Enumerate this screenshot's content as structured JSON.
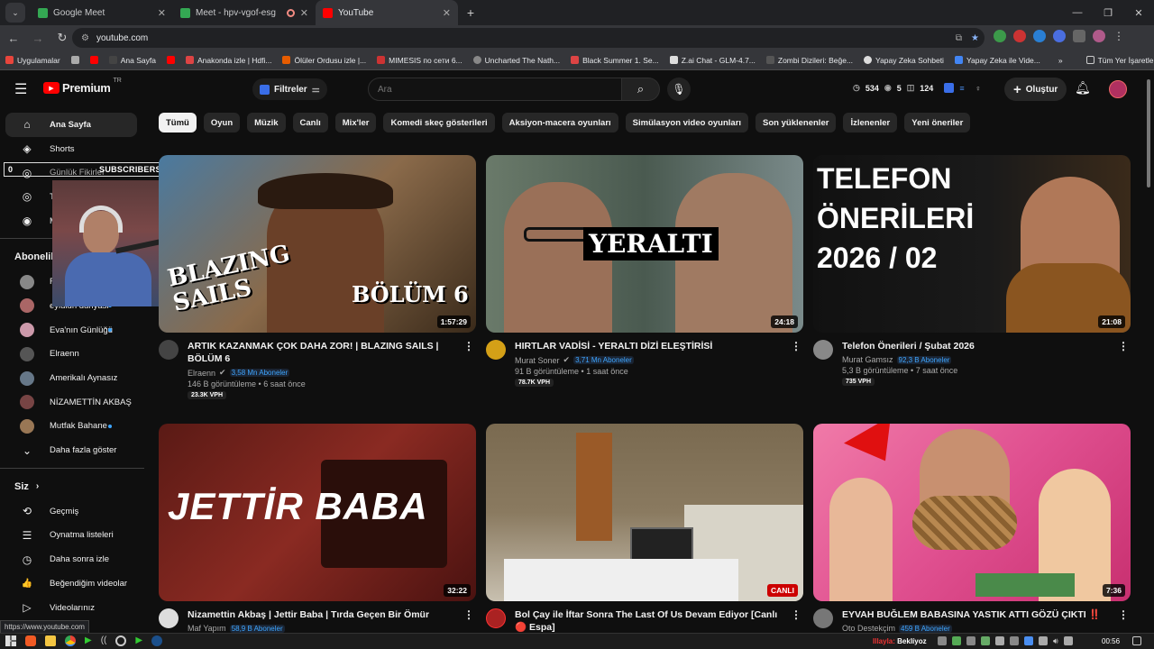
{
  "browser": {
    "tabs": [
      {
        "title": "Google Meet",
        "color": "#34a853",
        "active": false
      },
      {
        "title": "Meet - hpv-vgof-esg",
        "color": "#34a853",
        "active": false,
        "recording": true
      },
      {
        "title": "YouTube",
        "color": "#ff0000",
        "active": true
      }
    ],
    "url": "youtube.com",
    "bookmarks": [
      {
        "label": "Uygulamalar",
        "color": "#e8453c"
      },
      {
        "label": "",
        "color": "#aaa"
      },
      {
        "label": "",
        "color": "#ff0000"
      },
      {
        "label": "Ana Sayfa",
        "color": "#444"
      },
      {
        "label": "",
        "color": "#ff0000"
      },
      {
        "label": "Anakonda izle | Hdfi...",
        "color": "#d44"
      },
      {
        "label": "Ölüler Ordusu izle |...",
        "color": "#e65c00"
      },
      {
        "label": "MIMESIS по сети 6...",
        "color": "#c33"
      },
      {
        "label": "Uncharted The Nath...",
        "color": "#888"
      },
      {
        "label": "Black Summer 1. Se...",
        "color": "#d44"
      },
      {
        "label": "Z.ai Chat - GLM-4.7...",
        "color": "#ddd"
      },
      {
        "label": "Zombi Dizileri: Beğe...",
        "color": "#555"
      },
      {
        "label": "Yapay Zeka Sohbeti",
        "color": "#ddd"
      },
      {
        "label": "Yapay Zeka ile Vide...",
        "color": "#4285f4"
      }
    ],
    "bookmarks_more": "»",
    "all_bookmarks": "Tüm Yer İşaretleri",
    "status_url": "https://www.youtube.com"
  },
  "header": {
    "logo_text": "Premium",
    "logo_region": "TR",
    "filters_label": "Filtreler",
    "search_placeholder": "Ara",
    "stats": {
      "a": "534",
      "b": "5",
      "c": "124"
    },
    "create_label": "Oluştur"
  },
  "overlay": {
    "sub_count": "0",
    "sub_label": "SUBSCRIBERS",
    "sub_goal": "6"
  },
  "sidebar": {
    "main": [
      {
        "label": "Ana Sayfa",
        "icon": "home-icon",
        "glyph": "⌂",
        "active": true
      },
      {
        "label": "Shorts",
        "icon": "shorts-icon",
        "glyph": "◈"
      },
      {
        "label": "Günlük Fikirler",
        "icon": "ideas-icon",
        "glyph": "◎"
      },
      {
        "label": "T",
        "icon": "subscriptions-icon",
        "glyph": "◎"
      },
      {
        "label": "M",
        "icon": "music-icon",
        "glyph": "◉"
      }
    ],
    "subs_title": "Abonelik",
    "subs": [
      {
        "label": "RF",
        "color": "#888"
      },
      {
        "label": "eylulun dunyasi",
        "color": "#a66",
        "dot": true
      },
      {
        "label": "Eva'nın Günlüğü",
        "color": "#c9a",
        "dot": true
      },
      {
        "label": "Elraenn",
        "color": "#555"
      },
      {
        "label": "Amerikalı Aynasız",
        "color": "#678"
      },
      {
        "label": "NİZAMETTİN AKBAŞ",
        "color": "#744"
      },
      {
        "label": "Mutfak Bahane",
        "color": "#975",
        "dot": true
      }
    ],
    "more_label": "Daha fazla göster",
    "you_title": "Siz",
    "you": [
      {
        "label": "Geçmiş",
        "icon": "history-icon",
        "glyph": "⟲"
      },
      {
        "label": "Oynatma listeleri",
        "icon": "playlists-icon",
        "glyph": "☰"
      },
      {
        "label": "Daha sonra izle",
        "icon": "watch-later-icon",
        "glyph": "◷"
      },
      {
        "label": "Beğendiğim videolar",
        "icon": "like-icon",
        "glyph": "👍"
      },
      {
        "label": "Videolarınız",
        "icon": "your-videos-icon",
        "glyph": "▷"
      }
    ]
  },
  "chips": [
    "Tümü",
    "Oyun",
    "Müzik",
    "Canlı",
    "Mix'ler",
    "Komedi skeç gösterileri",
    "Aksiyon-macera oyunları",
    "Simülasyon video oyunları",
    "Son yüklenenler",
    "İzlenenler",
    "Yeni öneriler"
  ],
  "videos": [
    {
      "title": "ARTIK KAZANMAK ÇOK DAHA ZOR! | BLAZING SAILS | BÖLÜM 6",
      "channel": "Elraenn",
      "subs": "3,58 Mn Aboneler",
      "stats": "146 B görüntüleme • 6 saat önce",
      "vph": "23.3K VPH",
      "duration": "1:57:29",
      "thumb_text": "BLAZING SAILS",
      "thumb_sub": "BÖLÜM 6",
      "bg": "#8a6a4a",
      "av": "#444"
    },
    {
      "title": "HIRTLAR VADİSİ - YERALTI DİZİ ELEŞTİRİSİ",
      "channel": "Murat Soner",
      "subs": "3,71 Mn Aboneler",
      "stats": "91 B görüntüleme • 1 saat önce",
      "vph": "78.7K VPH",
      "duration": "24:18",
      "thumb_text": "YERALTI",
      "thumb_sub": "",
      "bg": "#5a6a5a",
      "av": "#d4a017"
    },
    {
      "title": "Telefon Önerileri / Şubat 2026",
      "channel": "Murat Gamsız",
      "subs": "92,3 B Aboneler",
      "stats": "5,3 B görüntüleme • 7 saat önce",
      "vph": "735 VPH",
      "duration": "21:08",
      "thumb_text": "TELEFON ÖNERİLERİ 2026 / 02",
      "thumb_sub": "",
      "bg": "#1a1a1a",
      "av": "#888"
    },
    {
      "title": "Nizamettin Akbaş | Jettir Baba | Tırda Geçen Bir Ömür",
      "channel": "Maf Yapım",
      "subs": "58,9 B Aboneler",
      "stats": "",
      "vph": "",
      "duration": "32:22",
      "thumb_text": "JETTİR BABA",
      "thumb_sub": "",
      "bg": "#7a2a22",
      "av": "#ddd"
    },
    {
      "title": "Bol Çay ile İftar Sonra The Last Of Us Devam Ediyor [Canlı 🔴 Espa]",
      "channel": "",
      "subs": "",
      "stats": "",
      "vph": "",
      "duration": "CANLI",
      "thumb_text": "",
      "thumb_sub": "",
      "bg": "#6a6050",
      "av": "#a22"
    },
    {
      "title": "EYVAH BUĞLEM BABASINA YASTIK ATTI GÖZÜ ÇIKTI ‼️",
      "channel": "Oto Destekçim",
      "subs": "459 B Aboneler",
      "stats": "",
      "vph": "",
      "duration": "7:36",
      "thumb_text": "",
      "thumb_sub": "",
      "bg": "#e06090",
      "av": "#777"
    }
  ],
  "taskbar": {
    "clock": "00:56",
    "notify": "Beklíyoz",
    "notify_user": "Illayla:"
  }
}
